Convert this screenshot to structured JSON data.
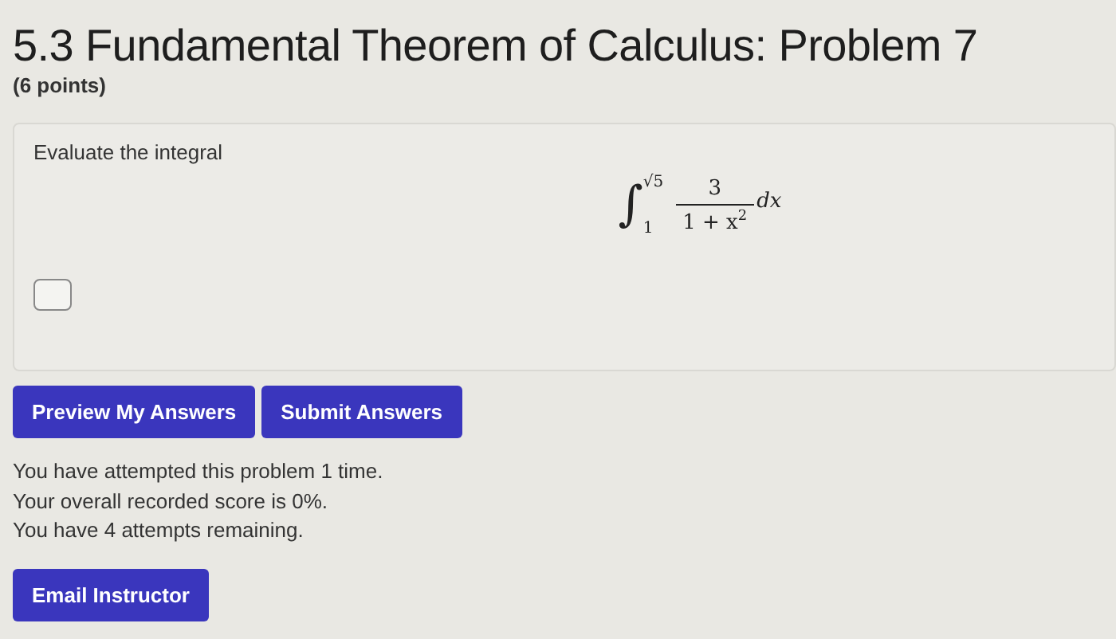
{
  "title": "5.3 Fundamental Theorem of Calculus: Problem 7",
  "points": "(6 points)",
  "problem": {
    "prompt": "Evaluate the integral",
    "integral": {
      "sign": "∫",
      "upper": "√5",
      "lower": "1",
      "numerator": "3",
      "denominator": "1 + x$^{2}$",
      "differential": "dx"
    }
  },
  "buttons": [
    "Preview My Answers",
    "Submit Answers"
  ],
  "messages": [
    "You have attempted this problem 1 time.",
    "Your overall recorded score is 0%.",
    "You have 4 attempts remaining."
  ],
  "email_button": "Email Instructor"
}
